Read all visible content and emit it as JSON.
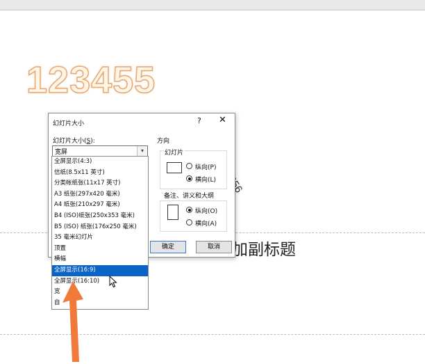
{
  "slide": {
    "title_text": "123455",
    "subtitle_text": "加副标题",
    "rotated_text": "656"
  },
  "dialog": {
    "title": "幻灯片大小",
    "help": "?",
    "close": "✕",
    "size_label_prefix": "幻灯片大小(",
    "size_label_key": "S",
    "size_label_suffix": "):",
    "combo_value": "宽屏",
    "combo_arrow": "▾",
    "orientation_label": "方向",
    "slides_group": {
      "title": "幻灯片",
      "portrait": "纵向(P)",
      "landscape": "横向(L)",
      "selected": "landscape"
    },
    "notes_group": {
      "title": "备注、讲义和大纲",
      "portrait": "纵向(O)",
      "landscape": "横向(A)",
      "selected": "portrait"
    },
    "ok": "确定",
    "cancel": "取消"
  },
  "dropdown": {
    "items": [
      "全屏显示(4:3)",
      "信纸(8.5x11 英寸)",
      "分类帐纸张(11x17 英寸)",
      "A3 纸张(297x420 毫米)",
      "A4 纸张(210x297 毫米)",
      "B4 (ISO)纸张(250x353 毫米)",
      "B5 (ISO) 纸张(176x250 毫米)",
      "35 毫米幻灯片",
      "顶置",
      "横幅",
      "全屏显示(16:9)",
      "全屏显示(16:10)",
      "宽",
      "自"
    ],
    "selected_index": 10
  },
  "colors": {
    "selection": "#0a64c8",
    "annotation_arrow": "#f07a3a",
    "title_outline": "#e8a86f"
  }
}
